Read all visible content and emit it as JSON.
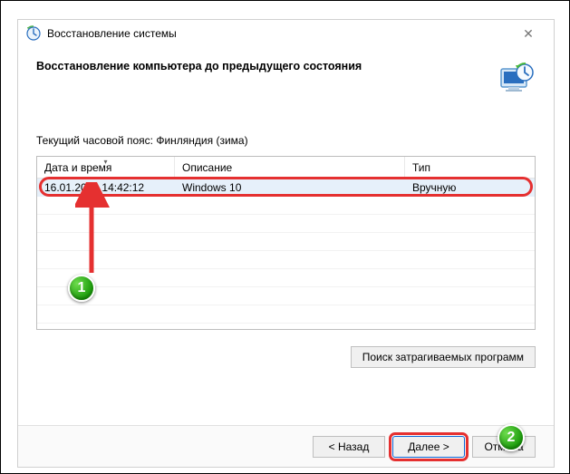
{
  "window": {
    "title": "Восстановление системы",
    "heading": "Восстановление компьютера до предыдущего состояния",
    "timezone_line": "Текущий часовой пояс: Финляндия (зима)"
  },
  "table": {
    "headers": {
      "date": "Дата и время",
      "desc": "Описание",
      "type": "Тип"
    },
    "rows": [
      {
        "date": "16.01.2019 14:42:12",
        "desc": "Windows 10",
        "type": "Вручную"
      }
    ]
  },
  "buttons": {
    "affected": "Поиск затрагиваемых программ",
    "back": "< Назад",
    "next": "Далее >",
    "cancel": "Отмена"
  },
  "annotations": {
    "badge1": "1",
    "badge2": "2"
  }
}
